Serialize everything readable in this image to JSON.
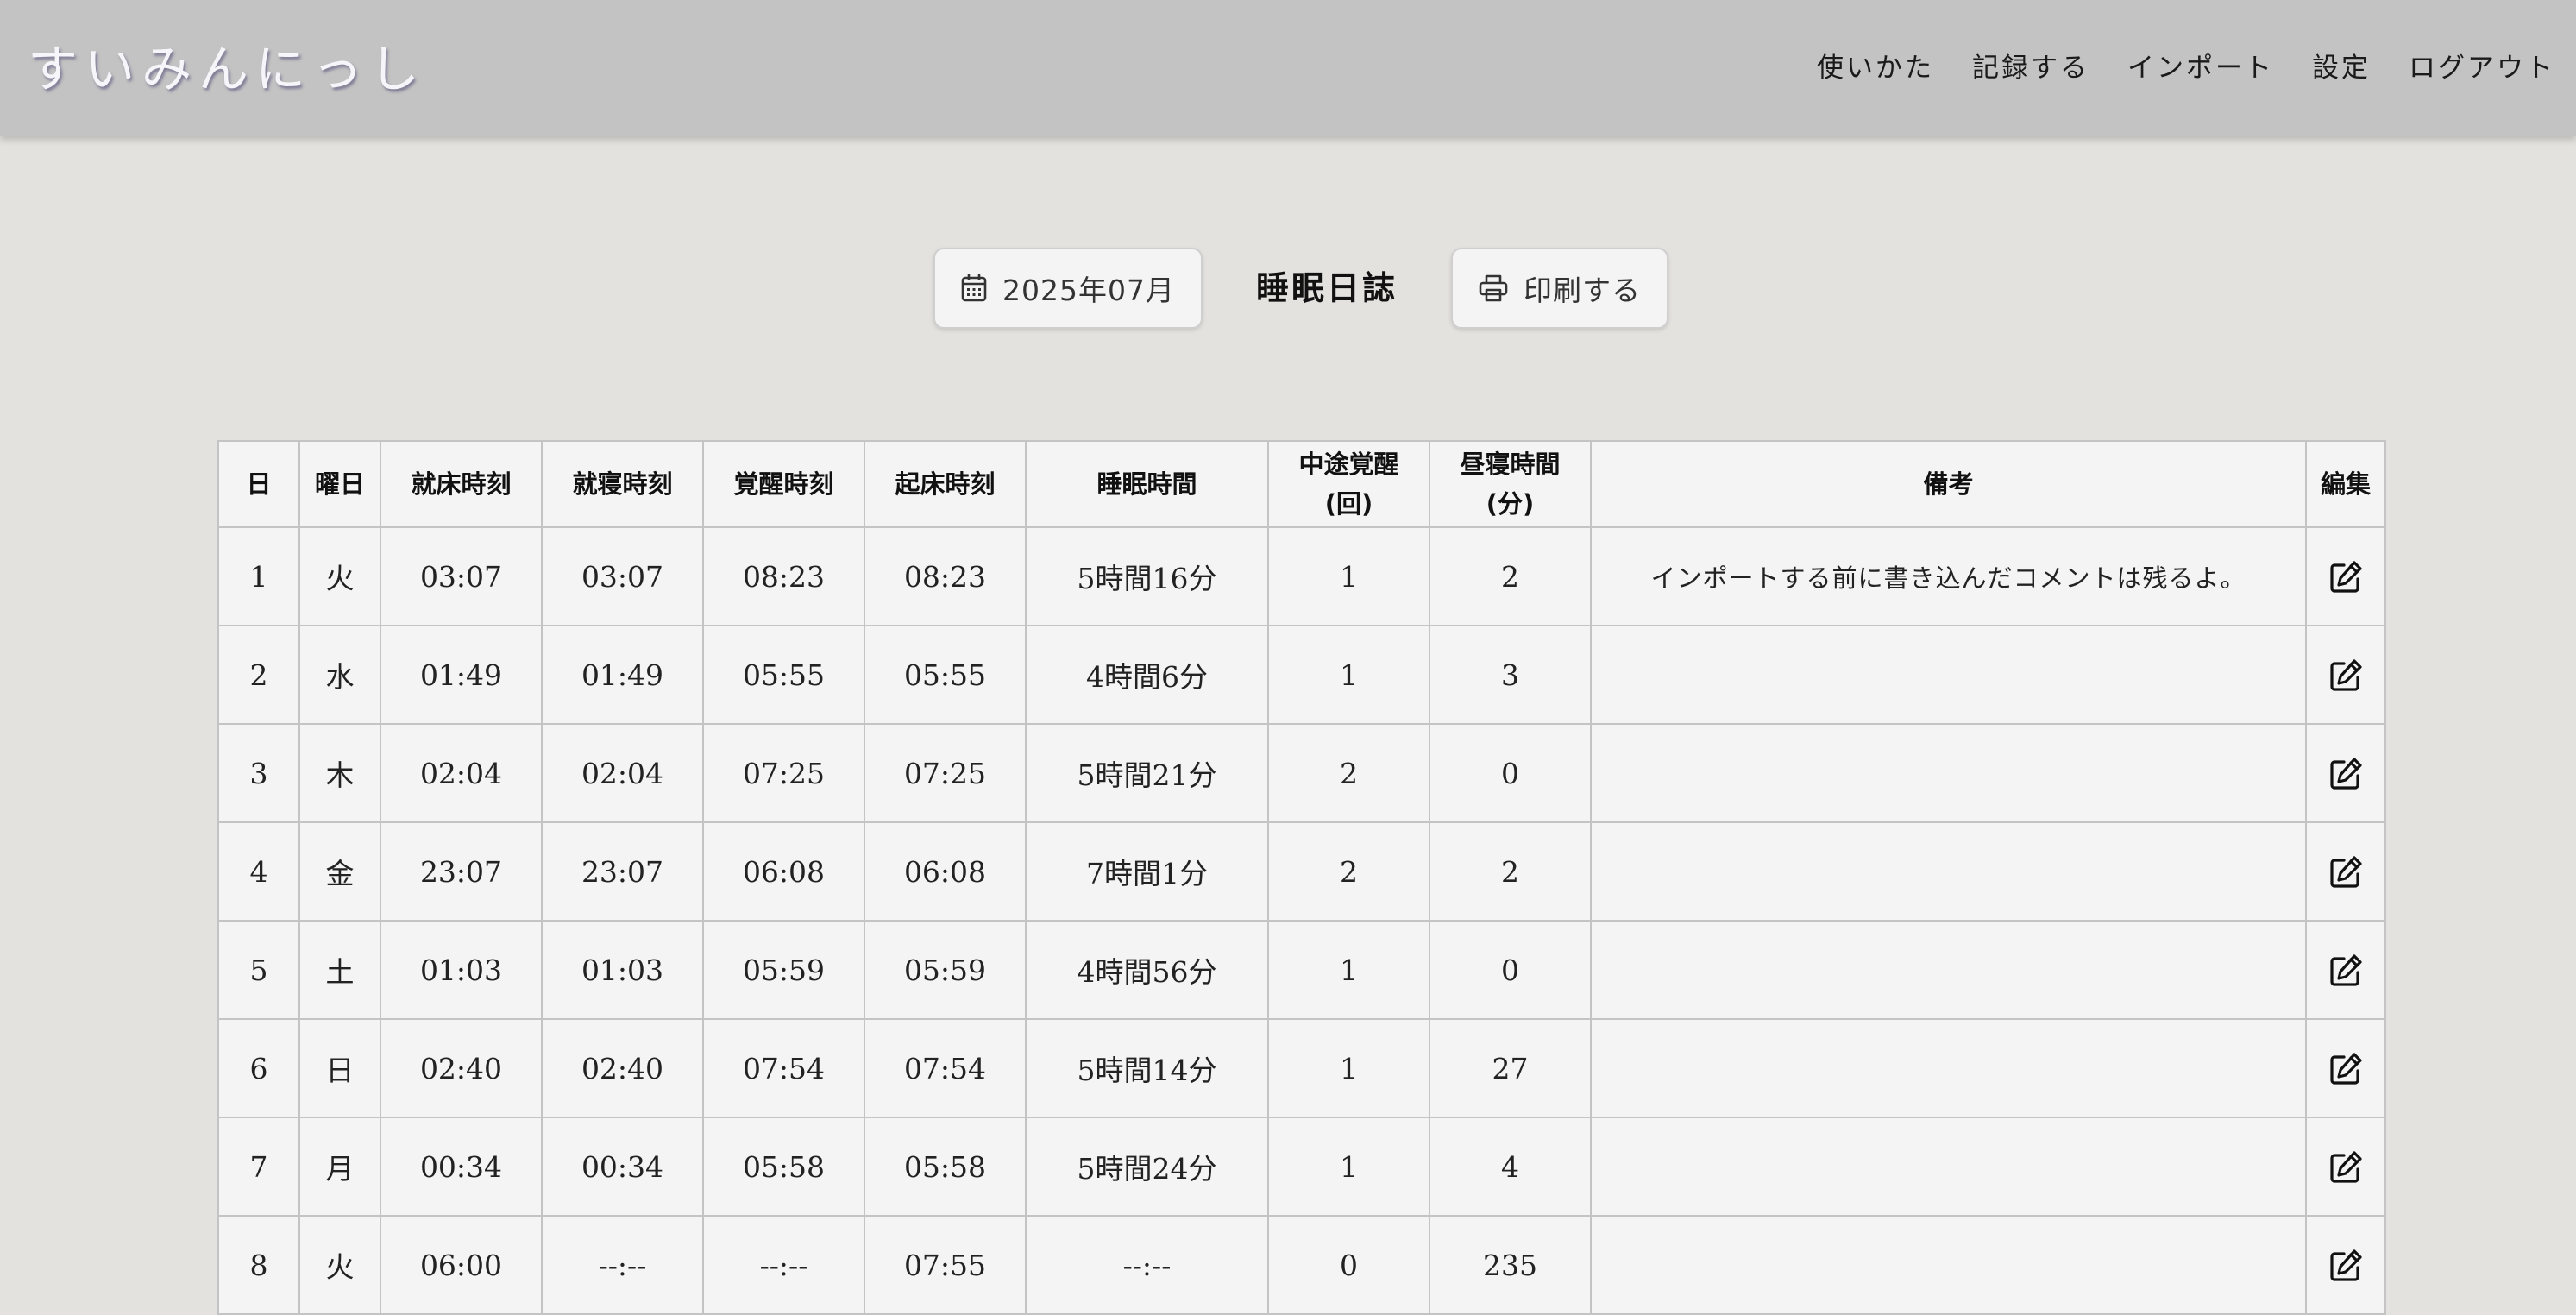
{
  "app": {
    "brand": "すいみんにっし"
  },
  "nav": {
    "items": [
      {
        "id": "howto",
        "label": "使いかた"
      },
      {
        "id": "record",
        "label": "記録する"
      },
      {
        "id": "import",
        "label": "インポート"
      },
      {
        "id": "settings",
        "label": "設定"
      },
      {
        "id": "logout",
        "label": "ログアウト"
      }
    ]
  },
  "toolbar": {
    "month_label": "2025年07月",
    "title": "睡眠日誌",
    "print_label": "印刷する"
  },
  "icons": {
    "month": "calendar-icon",
    "print": "printer-icon",
    "edit": "edit-icon"
  },
  "table": {
    "headers": {
      "day": "日",
      "weekday": "曜日",
      "bedtime": "就床時刻",
      "sleep_onset": "就寝時刻",
      "wake": "覚醒時刻",
      "getup": "起床時刻",
      "duration": "睡眠時間",
      "awakenings_line1": "中途覚醒",
      "awakenings_line2": "(回)",
      "nap_line1": "昼寝時間",
      "nap_line2": "(分)",
      "note": "備考",
      "edit": "編集"
    },
    "rows": [
      {
        "day": "1",
        "weekday": "火",
        "bedtime": "03:07",
        "sleep_onset": "03:07",
        "wake": "08:23",
        "getup": "08:23",
        "duration": "5時間16分",
        "awakenings": "1",
        "nap": "2",
        "note": "インポートする前に書き込んだコメントは残るよ。"
      },
      {
        "day": "2",
        "weekday": "水",
        "bedtime": "01:49",
        "sleep_onset": "01:49",
        "wake": "05:55",
        "getup": "05:55",
        "duration": "4時間6分",
        "awakenings": "1",
        "nap": "3",
        "note": ""
      },
      {
        "day": "3",
        "weekday": "木",
        "bedtime": "02:04",
        "sleep_onset": "02:04",
        "wake": "07:25",
        "getup": "07:25",
        "duration": "5時間21分",
        "awakenings": "2",
        "nap": "0",
        "note": ""
      },
      {
        "day": "4",
        "weekday": "金",
        "bedtime": "23:07",
        "sleep_onset": "23:07",
        "wake": "06:08",
        "getup": "06:08",
        "duration": "7時間1分",
        "awakenings": "2",
        "nap": "2",
        "note": ""
      },
      {
        "day": "5",
        "weekday": "土",
        "bedtime": "01:03",
        "sleep_onset": "01:03",
        "wake": "05:59",
        "getup": "05:59",
        "duration": "4時間56分",
        "awakenings": "1",
        "nap": "0",
        "note": ""
      },
      {
        "day": "6",
        "weekday": "日",
        "bedtime": "02:40",
        "sleep_onset": "02:40",
        "wake": "07:54",
        "getup": "07:54",
        "duration": "5時間14分",
        "awakenings": "1",
        "nap": "27",
        "note": ""
      },
      {
        "day": "7",
        "weekday": "月",
        "bedtime": "00:34",
        "sleep_onset": "00:34",
        "wake": "05:58",
        "getup": "05:58",
        "duration": "5時間24分",
        "awakenings": "1",
        "nap": "4",
        "note": ""
      },
      {
        "day": "8",
        "weekday": "火",
        "bedtime": "06:00",
        "sleep_onset": "--:--",
        "wake": "--:--",
        "getup": "07:55",
        "duration": "--:--",
        "awakenings": "0",
        "nap": "235",
        "note": ""
      }
    ]
  }
}
